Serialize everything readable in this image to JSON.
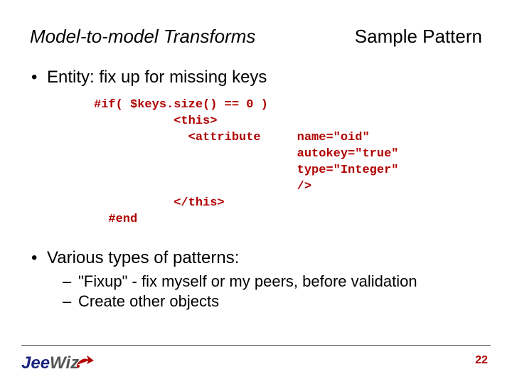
{
  "header": {
    "left": "Model-to-model Transforms",
    "right": "Sample Pattern"
  },
  "bullets": {
    "b1": "Entity: fix up for missing keys",
    "b2": "Various types of patterns:",
    "b2a": "\"Fixup\" - fix myself or my peers, before validation",
    "b2b": "Create other objects"
  },
  "code": "#if( $keys.size() == 0 )\n           <this>\n             <attribute     name=\"oid\"\n                            autokey=\"true\"\n                            type=\"Integer\"\n                            />\n           </this>\n  #end",
  "footer": {
    "page": "22",
    "logo_part1": "Jee",
    "logo_part2": "Wiz"
  }
}
